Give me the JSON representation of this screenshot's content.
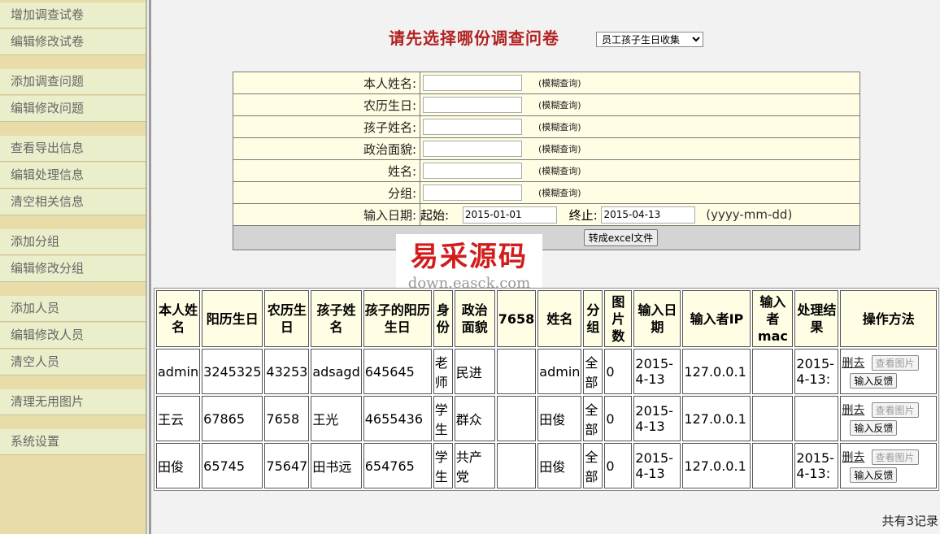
{
  "sidebar": {
    "items": [
      {
        "label": "增加调查试卷"
      },
      {
        "label": "编辑修改试卷"
      },
      {
        "label": "添加调查问题"
      },
      {
        "label": "编辑修改问题"
      },
      {
        "label": "查看导出信息"
      },
      {
        "label": "编辑处理信息"
      },
      {
        "label": "清空相关信息"
      },
      {
        "label": "添加分组"
      },
      {
        "label": "编辑修改分组"
      },
      {
        "label": "添加人员"
      },
      {
        "label": "编辑修改人员"
      },
      {
        "label": "清空人员"
      },
      {
        "label": "清理无用图片"
      },
      {
        "label": "系统设置"
      }
    ]
  },
  "header": {
    "title": "请先选择哪份调查问卷",
    "select_value": "员工孩子生日收集"
  },
  "form": {
    "hint": "(模糊查询)",
    "fields": [
      {
        "label": "本人姓名:"
      },
      {
        "label": "农历生日:"
      },
      {
        "label": "孩子姓名:"
      },
      {
        "label": "政治面貌:"
      },
      {
        "label": "姓名:"
      },
      {
        "label": "分组:"
      }
    ],
    "date": {
      "label": "输入日期:",
      "start_label": "起始:",
      "start_value": "2015-01-01",
      "end_label": "终止:",
      "end_value": "2015-04-13",
      "format_hint": "(yyyy-mm-dd)"
    },
    "export_button": "转成excel文件"
  },
  "watermark": {
    "text": "易采源码",
    "url": "down.easck.com"
  },
  "table": {
    "headers": [
      "本人姓名",
      "阳历生日",
      "农历生日",
      "孩子姓名",
      "孩子的阳历生日",
      "身份",
      "政治面貌",
      "7658",
      "姓名",
      "分组",
      "图片数",
      "输入日期",
      "输入者IP",
      "输入者mac",
      "处理结果",
      "操作方法"
    ],
    "rows": [
      {
        "cells": [
          "admin",
          "3245325",
          "43253",
          "adsagd",
          "645645",
          "老师",
          "民进",
          "",
          "admin",
          "全部",
          "0",
          "2015-4-13",
          "127.0.0.1",
          "",
          "2015-4-13:"
        ]
      },
      {
        "cells": [
          "王云",
          "67865",
          "7658",
          "王光",
          "4655436",
          "学生",
          "群众",
          "",
          "田俊",
          "全部",
          "0",
          "2015-4-13",
          "127.0.0.1",
          "",
          ""
        ]
      },
      {
        "cells": [
          "田俊",
          "65745",
          "75647",
          "田书远",
          "654765",
          "学生",
          "共产党",
          "",
          "田俊",
          "全部",
          "0",
          "2015-4-13",
          "127.0.0.1",
          "",
          "2015-4-13:"
        ]
      }
    ],
    "op": {
      "delete": "删去",
      "view_images": "查看图片",
      "feedback": "输入反馈"
    }
  },
  "footer": {
    "record_count": "共有3记录"
  }
}
